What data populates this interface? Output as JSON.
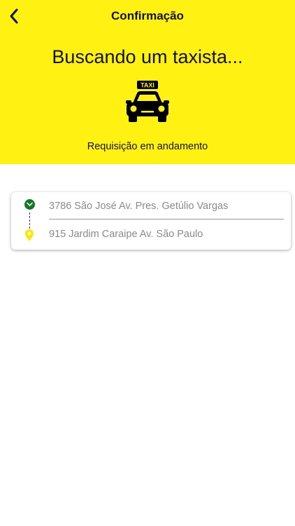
{
  "header": {
    "back_icon": "chevron-left-icon",
    "title": "Confirmação",
    "headline": "Buscando um taxista...",
    "taxi_icon": "taxi-icon",
    "taxi_sign": "TAXI",
    "status": "Requisição em andamento",
    "background_color": "#fff212"
  },
  "route": {
    "origin": {
      "icon": "check-circle-icon",
      "color": "#0c7a23",
      "address": "3786 São José Av. Pres. Getúlio Vargas"
    },
    "destination": {
      "icon": "map-pin-icon",
      "color": "#ffe600",
      "address": "915 Jardim Caraipe Av. São Paulo"
    }
  }
}
